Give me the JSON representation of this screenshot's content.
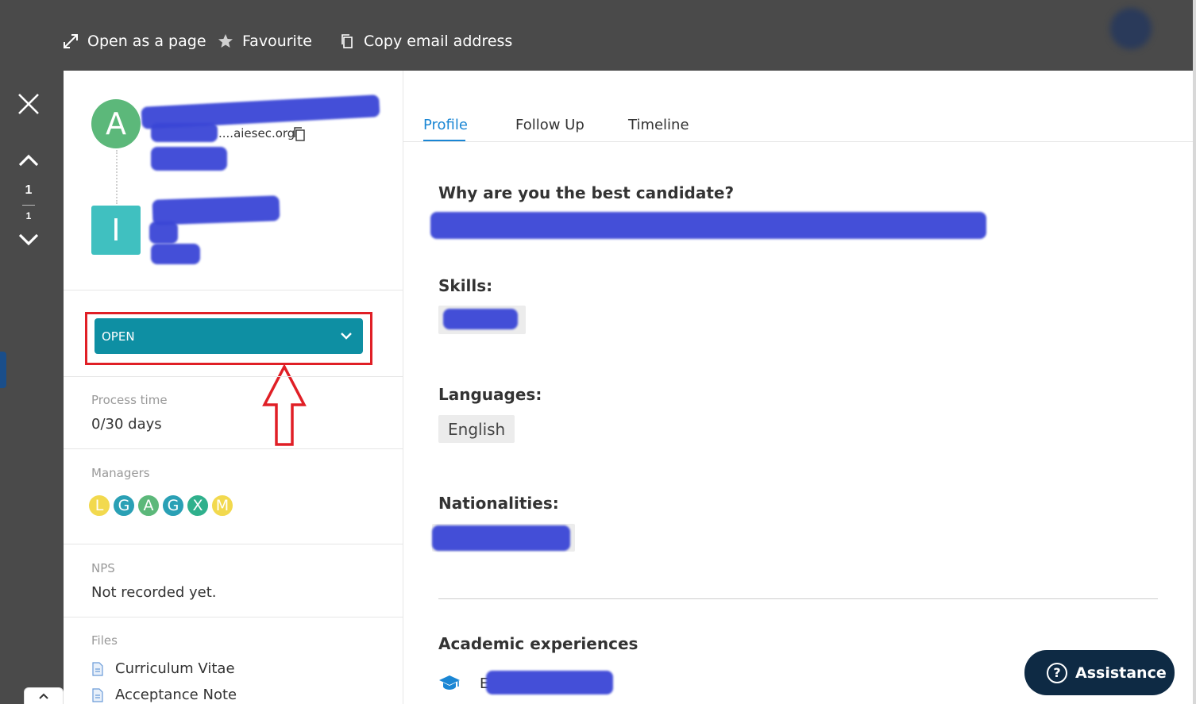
{
  "toolbar": {
    "open_as_page": "Open as a page",
    "favourite": "Favourite",
    "copy_email": "Copy email address"
  },
  "rail": {
    "current": "1",
    "total": "1"
  },
  "person": {
    "avatar_letter": "A",
    "email_suffix": "....aiesec.org",
    "org_letter": "I"
  },
  "status": {
    "value": "OPEN"
  },
  "process_time": {
    "label": "Process time",
    "value": "0/30 days"
  },
  "managers": {
    "label": "Managers",
    "items": [
      {
        "letter": "L",
        "color": "#f2d94e"
      },
      {
        "letter": "G",
        "color": "#2aa0b5"
      },
      {
        "letter": "A",
        "color": "#5cb87a"
      },
      {
        "letter": "G",
        "color": "#2aa0b5"
      },
      {
        "letter": "X",
        "color": "#2fb08c"
      },
      {
        "letter": "M",
        "color": "#f2d94e"
      }
    ]
  },
  "nps": {
    "label": "NPS",
    "value": "Not recorded yet."
  },
  "files": {
    "label": "Files",
    "items": [
      "Curriculum Vitae",
      "Acceptance Note"
    ]
  },
  "tabs": [
    "Profile",
    "Follow Up",
    "Timeline"
  ],
  "profile": {
    "why_best": "Why are you the best candidate?",
    "skills": "Skills:",
    "languages": "Languages:",
    "language_items": [
      "English"
    ],
    "nationalities": "Nationalities:",
    "academic": "Academic experiences",
    "academic_prefix": "E"
  },
  "assistance": {
    "label": "Assistance"
  },
  "colors": {
    "accent": "#1a86d4",
    "status_bg": "#0e8fa3",
    "highlight": "#e01f26",
    "redaction": "#3a46d6"
  }
}
